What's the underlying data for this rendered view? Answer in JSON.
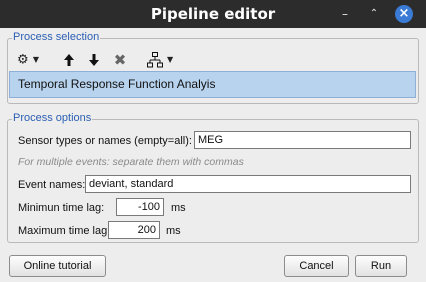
{
  "window": {
    "title": "Pipeline editor",
    "minimize_glyph": "–",
    "maximize_glyph": "⌃",
    "close_glyph": "×"
  },
  "process_selection": {
    "legend": "Process selection",
    "toolbar": {
      "gear_icon": "⚙",
      "move_up_icon": "🡅",
      "move_down_icon": "🡇",
      "delete_icon": "✖",
      "tree_icon": "⚡",
      "caret": "▼"
    },
    "selected_process": "Temporal Response Function Analyis"
  },
  "process_options": {
    "legend": "Process options",
    "sensor_label": "Sensor types or names (empty=all):",
    "sensor_value": "MEG",
    "hint": "For multiple events: separate them with commas",
    "event_label": "Event names:",
    "event_value": "deviant, standard",
    "min_lag_label": "Minimun time lag:",
    "min_lag_value": "-100",
    "min_lag_unit": "ms",
    "max_lag_label": "Maximum time lag:",
    "max_lag_value": "200",
    "max_lag_unit": "ms"
  },
  "buttons": {
    "tutorial": "Online tutorial",
    "cancel": "Cancel",
    "run": "Run"
  }
}
